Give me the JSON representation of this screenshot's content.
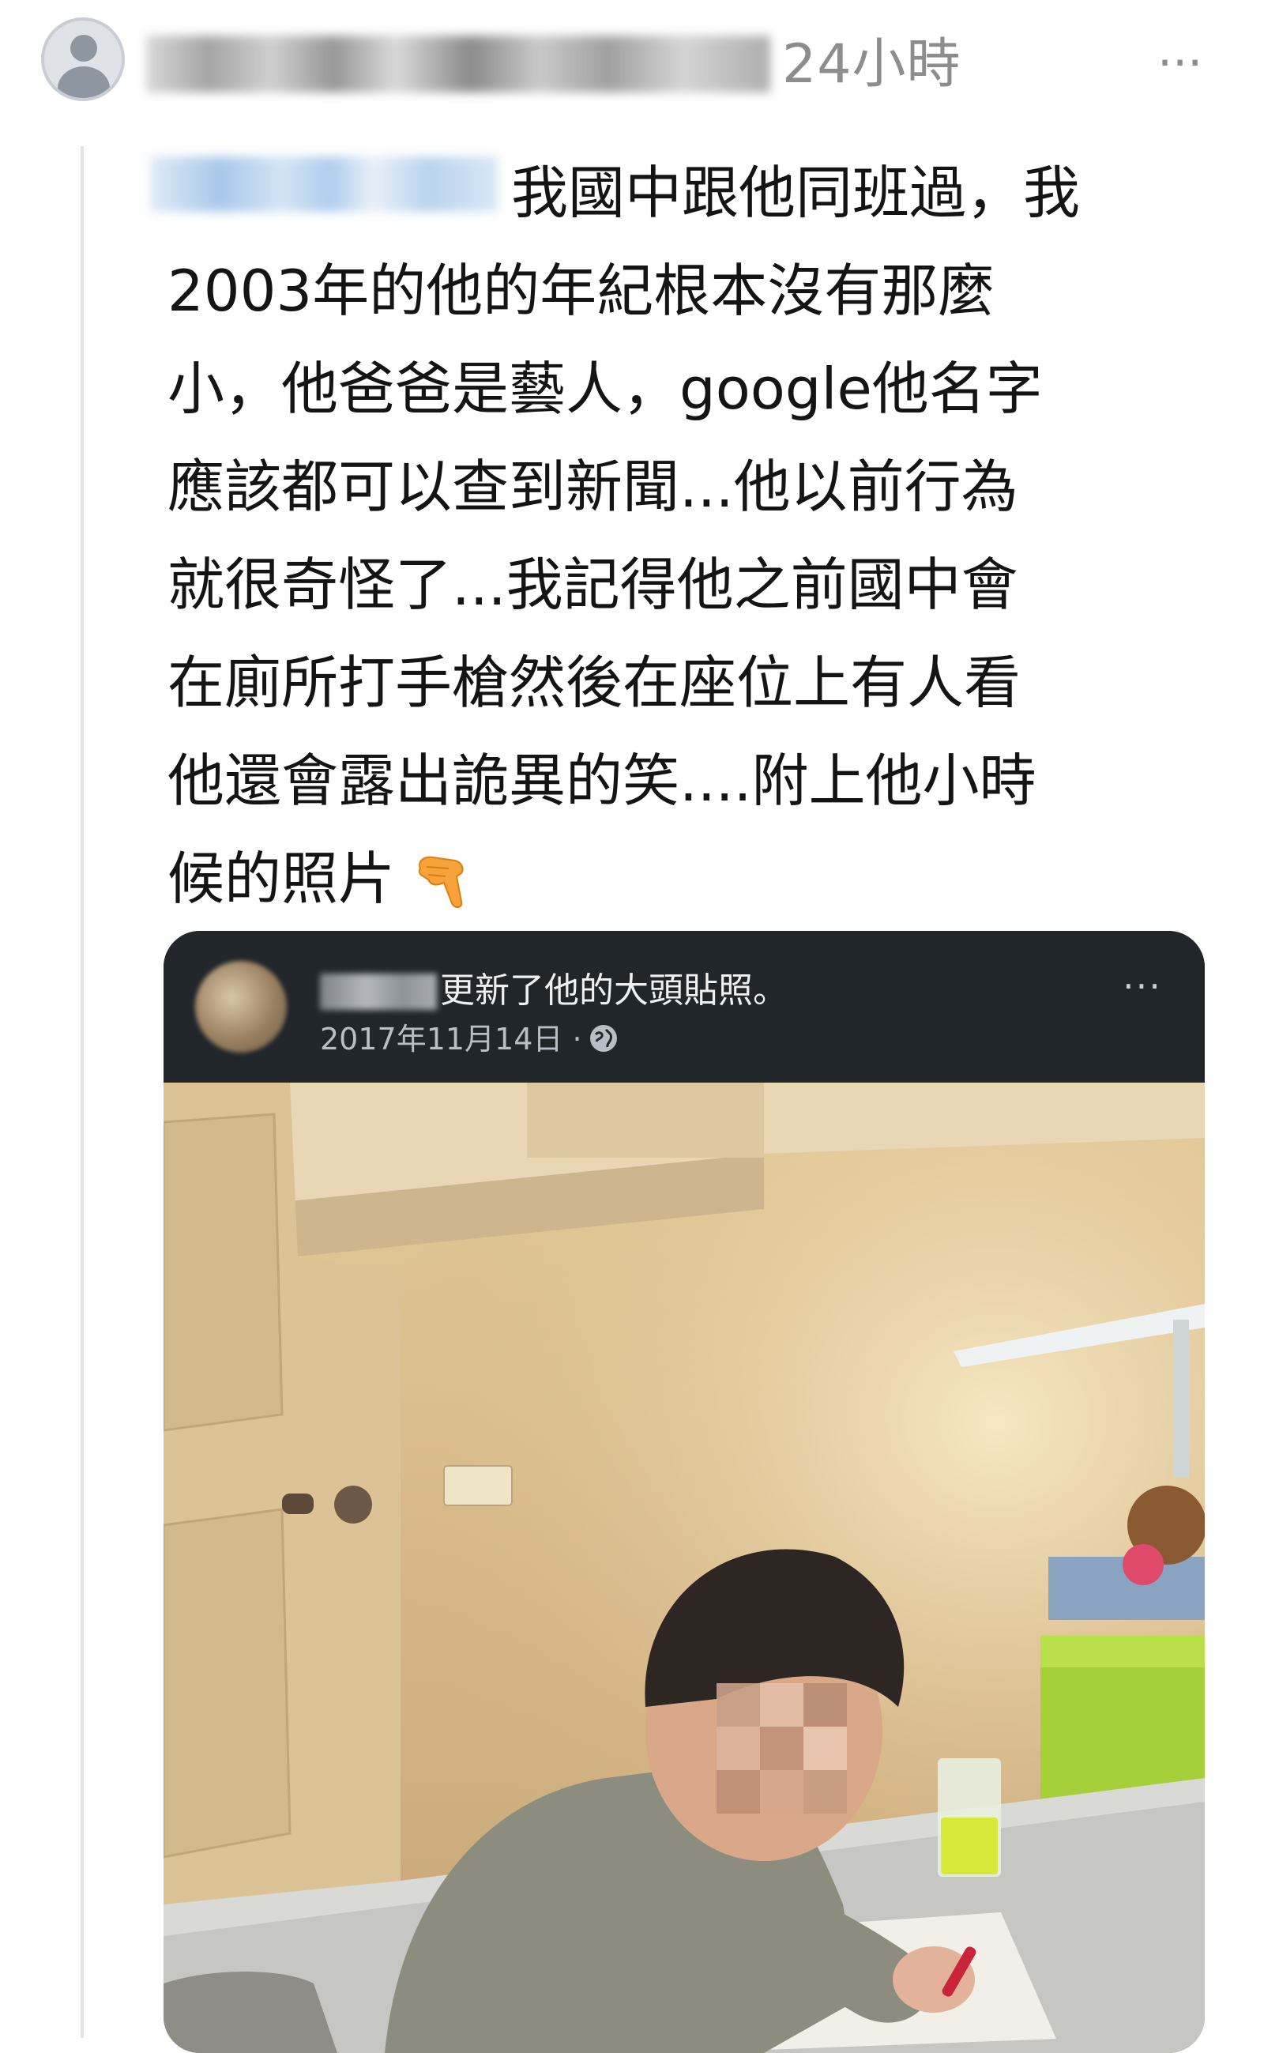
{
  "post": {
    "timestamp": "24小時",
    "more": "···",
    "lines": [
      "我國中跟他同班過，我",
      "2003年的他的年紀根本沒有那麼",
      "小，他爸爸是藝人，google他名字",
      "應該都可以查到新聞...他以前行為",
      "就很奇怪了...我記得他之前國中會",
      "在廁所打手槍然後在座位上有人看",
      "他還會露出詭異的笑....附上他小時",
      "候的照片"
    ]
  },
  "embedded": {
    "title": "更新了他的大頭貼照。",
    "date": "2017年11月14日 ·",
    "more": "···"
  },
  "icons": {
    "avatar": "default-user-icon",
    "hand": "backhand-index-pointing-down-emoji",
    "globe": "globe-icon"
  },
  "colors": {
    "timestamp": "#8d8d8d",
    "card_bg": "#21262b"
  }
}
